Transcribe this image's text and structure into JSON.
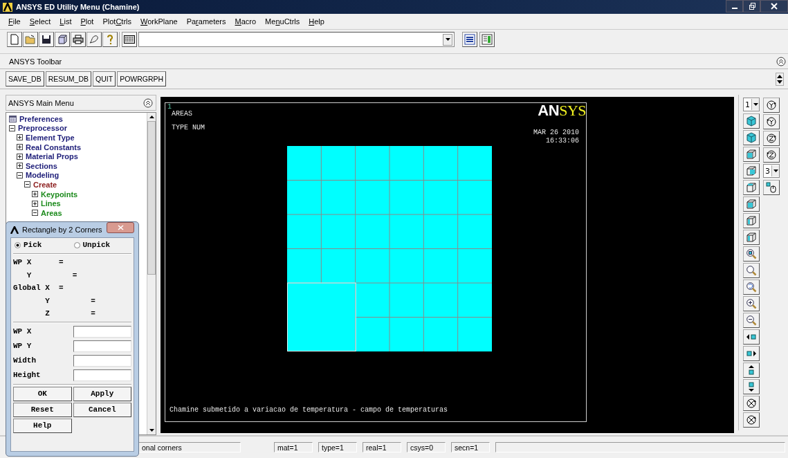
{
  "window": {
    "title": "ANSYS ED Utility Menu (Chamine)"
  },
  "menu_bar": [
    {
      "key": "F",
      "after": "ile"
    },
    {
      "key": "S",
      "after": "elect"
    },
    {
      "key": "L",
      "after": "ist"
    },
    {
      "key": "P",
      "after": "lot"
    },
    {
      "before": "Plot",
      "key": "C",
      "after": "trls"
    },
    {
      "key": "W",
      "after": "orkPlane"
    },
    {
      "before": "Pa",
      "key": "r",
      "after": "ameters"
    },
    {
      "key": "M",
      "after": "acro"
    },
    {
      "before": "Me",
      "key": "n",
      "after": "uCtrls"
    },
    {
      "key": "H",
      "after": "elp"
    }
  ],
  "ansys_toolbar": {
    "title": "ANSYS Toolbar",
    "buttons": [
      "SAVE_DB",
      "RESUM_DB",
      "QUIT",
      "POWRGRPH"
    ]
  },
  "main_menu": {
    "title": "ANSYS Main Menu",
    "items": [
      {
        "label": "Preferences",
        "kind": "leaf"
      },
      {
        "label": "Preprocessor",
        "kind": "folder",
        "expanded": true,
        "children": [
          {
            "label": "Element Type",
            "kind": "folder",
            "expanded": false
          },
          {
            "label": "Real Constants",
            "kind": "folder",
            "expanded": false
          },
          {
            "label": "Material Props",
            "kind": "folder",
            "expanded": false
          },
          {
            "label": "Sections",
            "kind": "folder",
            "expanded": false
          },
          {
            "label": "Modeling",
            "kind": "folder",
            "expanded": true,
            "children": [
              {
                "label": "Create",
                "kind": "folder",
                "expanded": true,
                "children": [
                  {
                    "label": "Keypoints",
                    "kind": "folder",
                    "expanded": false
                  },
                  {
                    "label": "Lines",
                    "kind": "folder",
                    "expanded": false
                  },
                  {
                    "label": "Areas",
                    "kind": "folder",
                    "expanded": true
                  }
                ]
              }
            ]
          }
        ]
      }
    ]
  },
  "graphics": {
    "window_number": "1",
    "plot_title": "AREAS",
    "numbering": "TYPE NUM",
    "logo_parts": [
      "AN",
      "SYS"
    ],
    "date": "MAR 26 2010",
    "time": "16:33:06",
    "caption": "Chamine submetido a variacao de temperatura - campo de temperaturas"
  },
  "right_toolbar": {
    "view_dropdown": "1",
    "rotation_dropdown": "3"
  },
  "dialog": {
    "title": "Rectangle by 2 Corners",
    "modes": [
      {
        "label": "Pick",
        "selected": true
      },
      {
        "label": "Unpick",
        "selected": false
      }
    ],
    "coordinate_groups": [
      {
        "prefix": "WP",
        "axes": [
          {
            "axis": "X",
            "sign": "="
          },
          {
            "axis": "Y",
            "sign": "="
          }
        ]
      },
      {
        "prefix": "Global",
        "axes": [
          {
            "axis": "X",
            "sign": "="
          },
          {
            "axis": "Y",
            "sign": "="
          },
          {
            "axis": "Z",
            "sign": "="
          }
        ]
      }
    ],
    "inputs": [
      {
        "label": "WP X"
      },
      {
        "label": "WP Y"
      },
      {
        "label": "Width"
      },
      {
        "label": "Height"
      }
    ],
    "buttons": [
      "OK",
      "Apply",
      "Reset",
      "Cancel",
      "Help"
    ]
  },
  "status_bar": {
    "fields": [
      "onal corners",
      "mat=1",
      "type=1",
      "real=1",
      "csys=0",
      "secn=1"
    ]
  }
}
